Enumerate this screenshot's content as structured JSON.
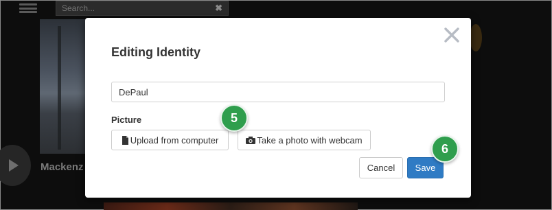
{
  "background": {
    "search_placeholder": "Search...",
    "clear_glyph": "✖",
    "featured_name": "Mackenz"
  },
  "modal": {
    "title": "Editing Identity",
    "name_value": "DePaul",
    "picture_label": "Picture",
    "upload_button": "Upload from computer",
    "webcam_button": "Take a photo with webcam",
    "cancel_button": "Cancel",
    "save_button": "Save",
    "upload_icon": "file-icon",
    "webcam_icon": "camera-icon",
    "close_icon": "close-icon"
  },
  "badges": {
    "step_a": "5",
    "step_b": "6"
  },
  "colors": {
    "save_bg": "#2f7bc4",
    "badge_green": "#2f9e4d"
  }
}
